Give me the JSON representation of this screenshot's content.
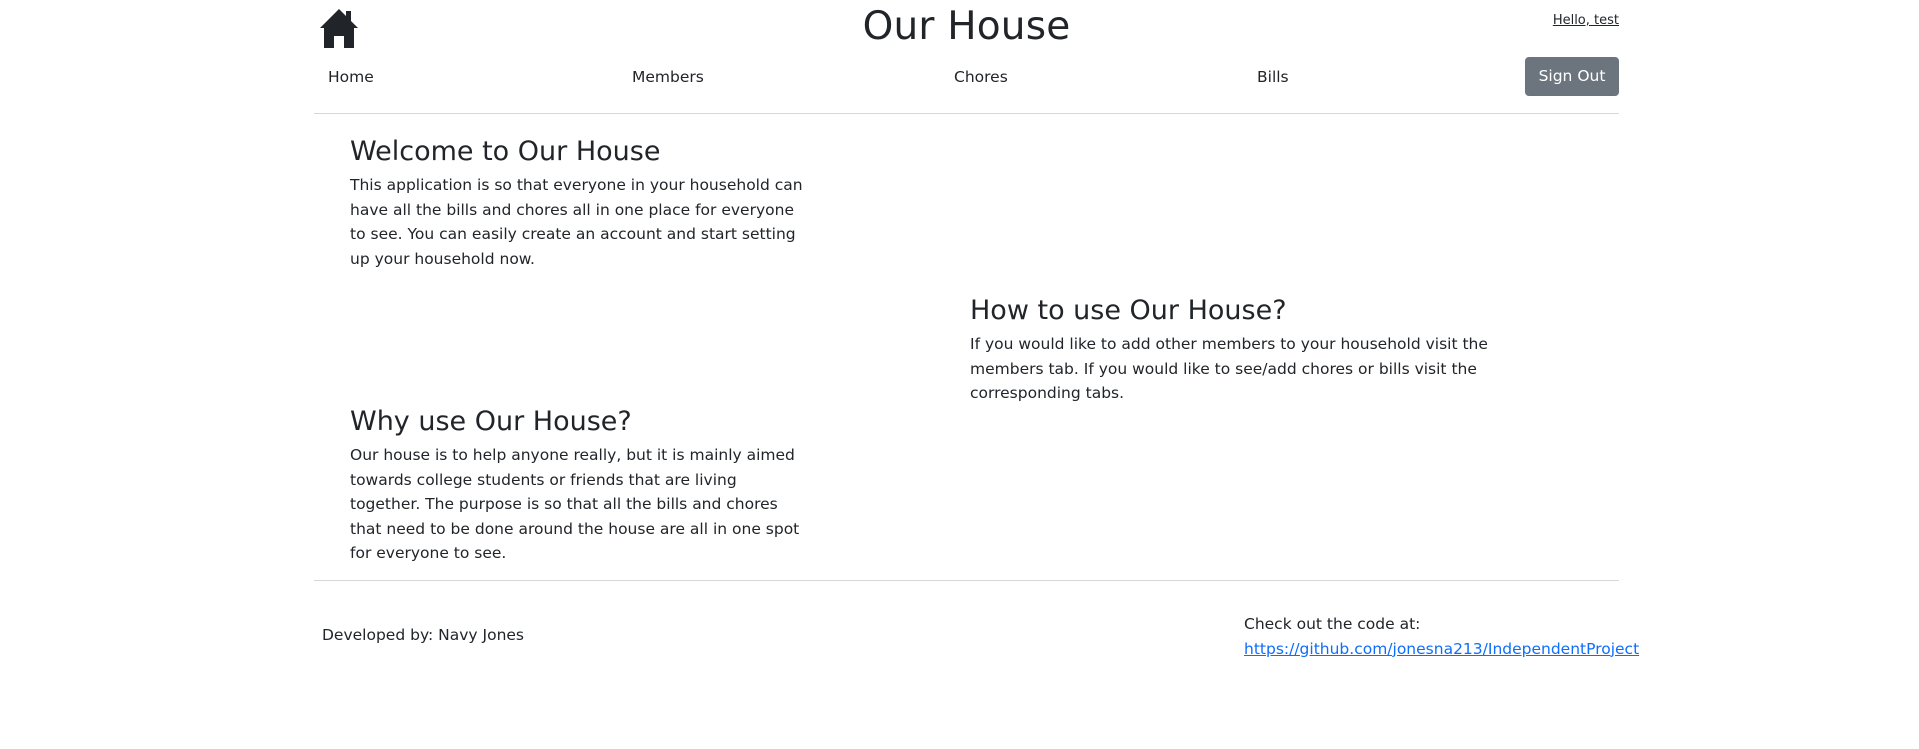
{
  "header": {
    "title": "Our House",
    "greeting": "Hello, test",
    "logo_icon": "house-icon"
  },
  "nav": {
    "items": [
      {
        "label": "Home"
      },
      {
        "label": "Members"
      },
      {
        "label": "Chores"
      },
      {
        "label": "Bills"
      }
    ],
    "signout_label": "Sign Out"
  },
  "sections": {
    "welcome": {
      "heading": "Welcome to Our House",
      "text": "This application is so that everyone in your household can have all the bills and chores all in one place for everyone to see. You can easily create an account and start setting up your household now."
    },
    "howto": {
      "heading": "How to use Our House?",
      "text": "If you would like to add other members to your household visit the members tab. If you would like to see/add chores or bills visit the corresponding tabs."
    },
    "why": {
      "heading": "Why use Our House?",
      "text": "Our house is to help anyone really, but it is mainly aimed towards college students or friends that are living together. The purpose is so that all the bills and chores that need to be done around the house are all in one spot for everyone to see."
    }
  },
  "footer": {
    "developer": "Developed by: Navy Jones",
    "code_label": "Check out the code at:",
    "code_link": "https://github.com/jonesna213/IndependentProject"
  },
  "colors": {
    "text": "#212529",
    "button_bg": "#6c757d",
    "link": "#0d6efd",
    "divider": "#d6d8db"
  }
}
